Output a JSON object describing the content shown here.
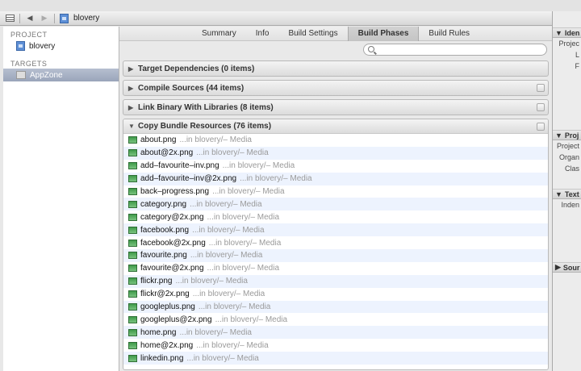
{
  "jumpbar": {
    "title": "blovery"
  },
  "navigator": {
    "project_header": "PROJECT",
    "project_name": "blovery",
    "targets_header": "TARGETS",
    "target_name": "AppZone"
  },
  "tabs": [
    {
      "label": "Summary"
    },
    {
      "label": "Info"
    },
    {
      "label": "Build Settings"
    },
    {
      "label": "Build Phases",
      "active": true
    },
    {
      "label": "Build Rules"
    }
  ],
  "search": {
    "placeholder": ""
  },
  "phases": [
    {
      "title": "Target Dependencies (0 items)"
    },
    {
      "title": "Compile Sources (44 items)"
    },
    {
      "title": "Link Binary With Libraries (8 items)"
    }
  ],
  "copy_bundle": {
    "title": "Copy Bundle Resources (76 items)",
    "files": [
      {
        "name": "about.png",
        "location": "...in blovery/– Media"
      },
      {
        "name": "about@2x.png",
        "location": "...in blovery/– Media"
      },
      {
        "name": "add–favourite–inv.png",
        "location": "...in blovery/– Media"
      },
      {
        "name": "add–favourite–inv@2x.png",
        "location": "...in blovery/– Media"
      },
      {
        "name": "back–progress.png",
        "location": "...in blovery/– Media"
      },
      {
        "name": "category.png",
        "location": "...in blovery/– Media"
      },
      {
        "name": "category@2x.png",
        "location": "...in blovery/– Media"
      },
      {
        "name": "facebook.png",
        "location": "...in blovery/– Media"
      },
      {
        "name": "facebook@2x.png",
        "location": "...in blovery/– Media"
      },
      {
        "name": "favourite.png",
        "location": "...in blovery/– Media"
      },
      {
        "name": "favourite@2x.png",
        "location": "...in blovery/– Media"
      },
      {
        "name": "flickr.png",
        "location": "...in blovery/– Media"
      },
      {
        "name": "flickr@2x.png",
        "location": "...in blovery/– Media"
      },
      {
        "name": "googleplus.png",
        "location": "...in blovery/– Media"
      },
      {
        "name": "googleplus@2x.png",
        "location": "...in blovery/– Media"
      },
      {
        "name": "home.png",
        "location": "...in blovery/– Media"
      },
      {
        "name": "home@2x.png",
        "location": "...in blovery/– Media"
      },
      {
        "name": "linkedin.png",
        "location": "...in blovery/– Media"
      }
    ]
  },
  "inspector": {
    "sections": [
      {
        "title": "Iden",
        "labels": [
          "Projec",
          "L",
          "F"
        ]
      },
      {
        "title": "Proj",
        "labels": [
          "Project",
          "Organ",
          "Clas"
        ]
      },
      {
        "title": "Text",
        "labels": [
          "Inden"
        ]
      },
      {
        "title": "Sour",
        "labels": []
      }
    ]
  }
}
